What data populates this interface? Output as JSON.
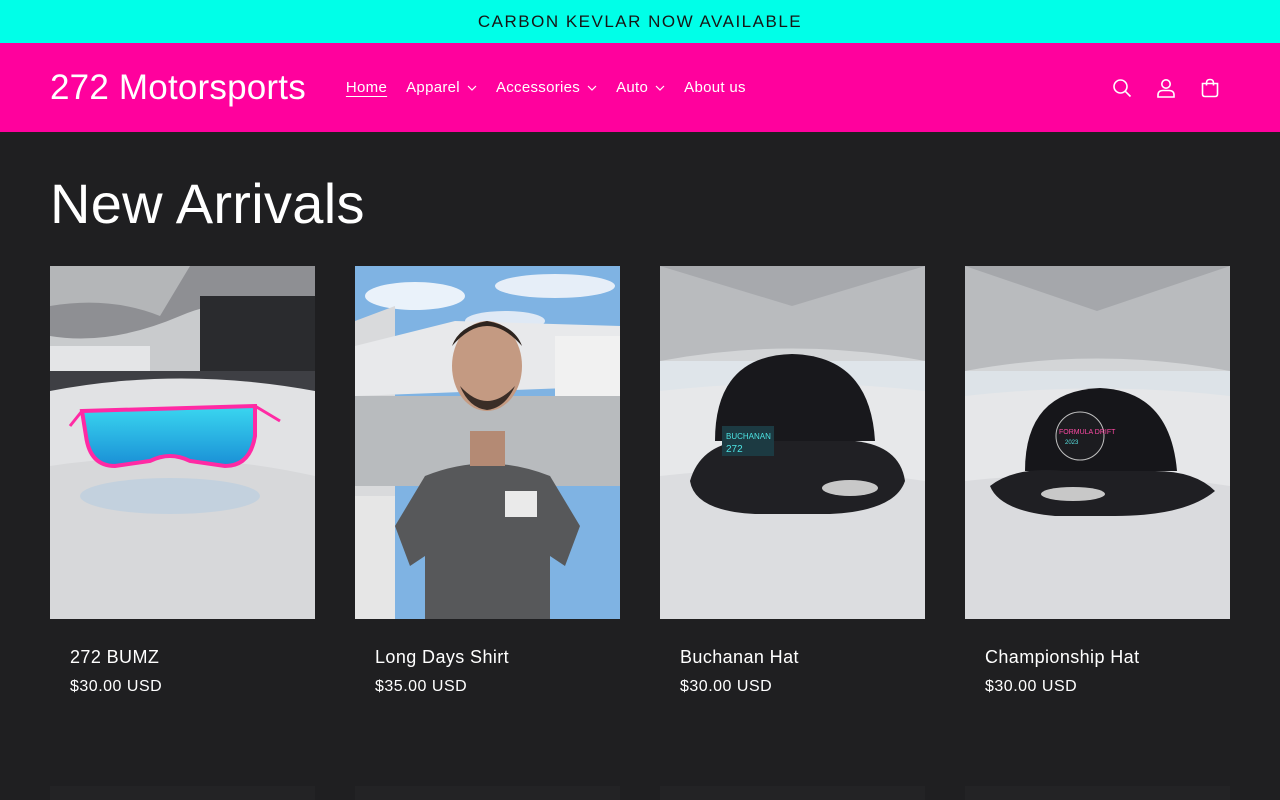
{
  "announcement": "CARBON KEVLAR NOW AVAILABLE",
  "header": {
    "logo": "272 Motorsports",
    "nav": [
      {
        "label": "Home",
        "active": true,
        "dropdown": false
      },
      {
        "label": "Apparel",
        "active": false,
        "dropdown": true
      },
      {
        "label": "Accessories",
        "active": false,
        "dropdown": true
      },
      {
        "label": "Auto",
        "active": false,
        "dropdown": true
      },
      {
        "label": "About us",
        "active": false,
        "dropdown": false
      }
    ],
    "icons": [
      "search-icon",
      "account-icon",
      "cart-icon"
    ]
  },
  "section": {
    "title": "New Arrivals",
    "products": [
      {
        "name": "272 BUMZ",
        "price": "$30.00 USD",
        "image": "sunglasses-photo"
      },
      {
        "name": "Long Days Shirt",
        "price": "$35.00 USD",
        "image": "shirt-photo"
      },
      {
        "name": "Buchanan Hat",
        "price": "$30.00 USD",
        "image": "hat-photo"
      },
      {
        "name": "Championship Hat",
        "price": "$30.00 USD",
        "image": "hat-photo"
      }
    ]
  },
  "colors": {
    "announcement_bg": "#00ffe8",
    "header_bg": "#ff019d",
    "page_bg": "#1f1f21"
  }
}
